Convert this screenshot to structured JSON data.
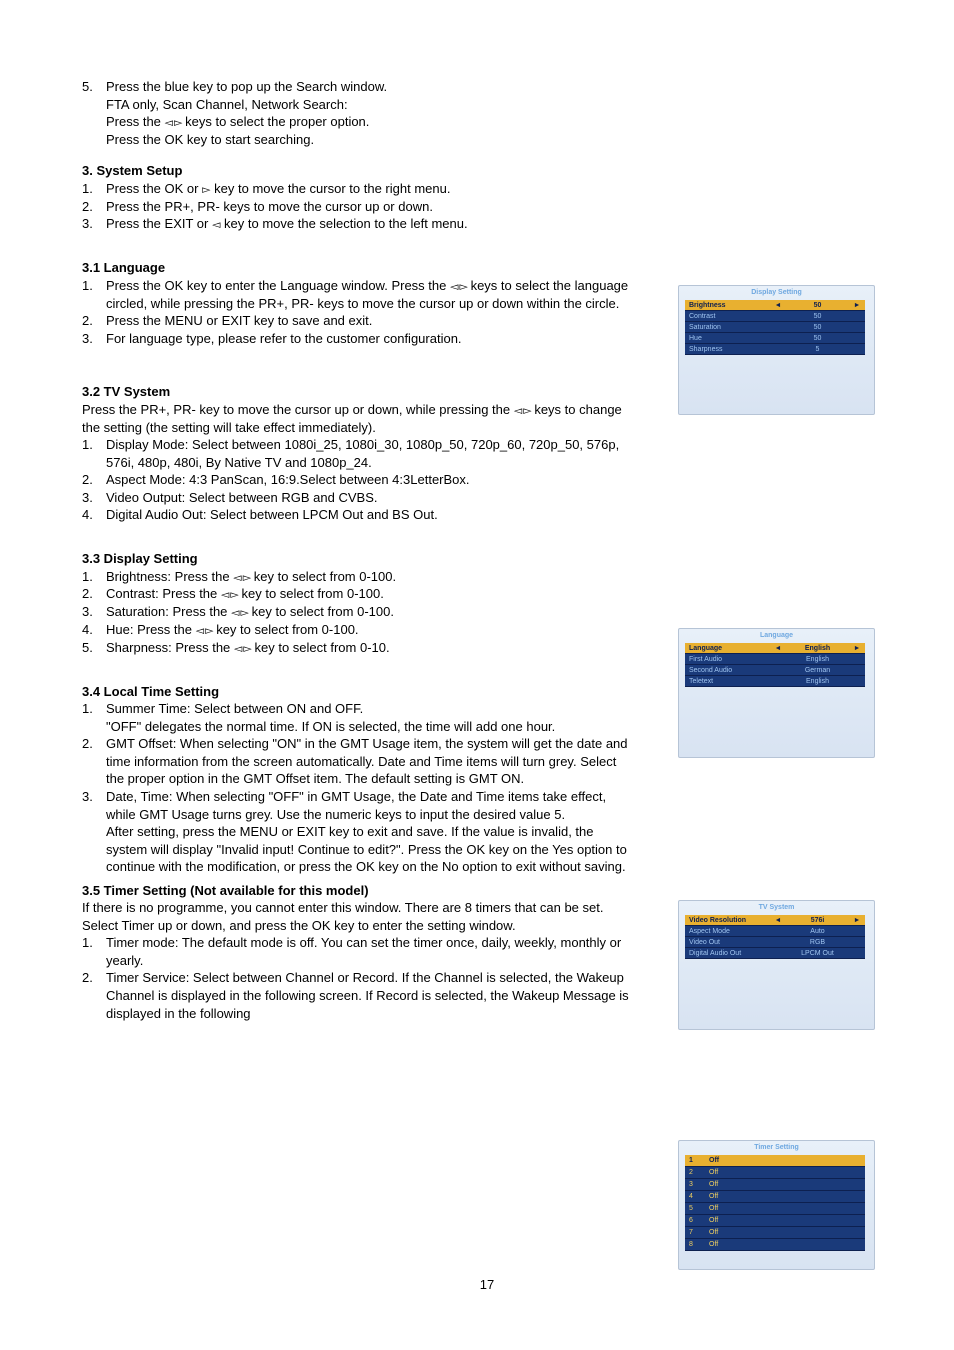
{
  "intro": {
    "item5_line1": "Press the blue key to pop up the Search window.",
    "item5_line2": "FTA only, Scan Channel, Network Search:",
    "item5_line3_a": "Press the ",
    "item5_line3_b": " keys to select the proper option.",
    "item5_line4": "Press the OK key to start searching."
  },
  "s3": {
    "title": "3.   System Setup",
    "items": [
      {
        "n": "1.",
        "a": "Press the OK or ",
        "icon": "r",
        "b": " key to move the cursor to the right menu."
      },
      {
        "n": "2.",
        "a": "Press the PR+, PR- keys to move the cursor up or down."
      },
      {
        "n": "3.",
        "a": "Press the EXIT or ",
        "icon": "l",
        "b": " key to move the selection to the left menu."
      }
    ]
  },
  "s31": {
    "title": "3.1  Language",
    "items": [
      {
        "n": "1.",
        "a": "Press the OK key to enter the Language window. Press the ",
        "icon": "lr",
        "b": " keys to select the language circled, while pressing the PR+, PR- keys to move the cursor up or down within the circle."
      },
      {
        "n": "2.",
        "a": "Press the MENU or EXIT key to save and exit."
      },
      {
        "n": "3.",
        "a": "For language type, please refer to the customer configuration."
      }
    ]
  },
  "s32": {
    "title": "3.2  TV System",
    "lead_a": "Press the PR+, PR- key to move the cursor up or down, while pressing the ",
    "lead_b": " keys to change the setting (the setting will take effect immediately).",
    "items": [
      {
        "n": "1.",
        "a": "Display Mode: Select between 1080i_25, 1080i_30, 1080p_50, 720p_60, 720p_50, 576p, 576i, 480p, 480i, By Native TV and 1080p_24."
      },
      {
        "n": "2.",
        "a": "Aspect Mode: 4:3 PanScan, 16:9.Select between 4:3LetterBox."
      },
      {
        "n": "3.",
        "a": "Video Output: Select between RGB and CVBS."
      },
      {
        "n": "4.",
        "a": "Digital Audio Out: Select between LPCM Out and BS Out."
      }
    ]
  },
  "s33": {
    "title": "3.3  Display Setting",
    "items": [
      {
        "n": "1.",
        "a": "Brightness: Press the ",
        "icon": "lr",
        "b": " key to select from 0-100."
      },
      {
        "n": "2.",
        "a": "Contrast: Press the ",
        "icon": "lr",
        "b": " key to select from 0-100."
      },
      {
        "n": "3.",
        "a": "Saturation: Press the ",
        "icon": "lr",
        "b": " key to select from 0-100."
      },
      {
        "n": "4.",
        "a": "Hue: Press the ",
        "icon": "lr",
        "b": " key to select from 0-100."
      },
      {
        "n": "5.",
        "a": "Sharpness: Press the ",
        "icon": "lr",
        "b": " key to select from 0-10."
      }
    ]
  },
  "s34": {
    "title": "3.4  Local Time Setting",
    "items": [
      {
        "n": "1.",
        "a": "Summer Time: Select between ON and OFF.",
        "cont": [
          "\"OFF\" delegates the normal time. If ON is selected, the time will add one hour."
        ]
      },
      {
        "n": "2.",
        "a": "GMT Offset: When selecting \"ON\" in the GMT Usage item, the system will get the date and time information from the screen automatically. Date and Time items will turn grey. Select the proper option in the GMT Offset item. The default setting is GMT ON."
      },
      {
        "n": "3.",
        "a": "Date, Time: When selecting \"OFF\" in GMT Usage, the Date and Time items take effect, while GMT Usage turns grey. Use the numeric keys to input the desired value 5.",
        "cont": [
          "After setting, press the MENU or EXIT key to exit and save. If the value is invalid, the system will display \"Invalid input! Continue to edit?\". Press the OK key on the Yes option to continue with the modification, or press the OK key on the No option to exit without saving."
        ]
      }
    ]
  },
  "s35": {
    "title": "3.5  Timer Setting (Not available for this model)",
    "lead1": "If there is no programme, you cannot enter this window. There are 8 timers that can be set.",
    "lead2": "Select Timer up or down, and press the OK key to enter the setting window.",
    "items": [
      {
        "n": "1.",
        "a": "Timer mode: The default mode is off. You can set the timer once, daily, weekly, monthly or yearly."
      },
      {
        "n": "2.",
        "a": "Timer Service: Select between Channel or Record. If the Channel is selected, the Wakeup Channel is displayed in the following screen. If Record is selected, the Wakeup Message is displayed in the following"
      }
    ]
  },
  "page_number": "17",
  "shots": {
    "display": {
      "title": "Display Setting",
      "rows": [
        {
          "k": "Brightness",
          "v": "50",
          "sel": true
        },
        {
          "k": "Contrast",
          "v": "50"
        },
        {
          "k": "Saturation",
          "v": "50"
        },
        {
          "k": "Hue",
          "v": "50"
        },
        {
          "k": "Sharpness",
          "v": "5"
        }
      ]
    },
    "language": {
      "title": "Language",
      "rows": [
        {
          "k": "Language",
          "v": "English",
          "sel": true
        },
        {
          "k": "First Audio",
          "v": "English"
        },
        {
          "k": "Second Audio",
          "v": "German"
        },
        {
          "k": "Teletext",
          "v": "English"
        }
      ]
    },
    "tvsys": {
      "title": "TV System",
      "rows": [
        {
          "k": "Video Resolution",
          "v": "576i",
          "sel": true
        },
        {
          "k": "Aspect Mode",
          "v": "Auto"
        },
        {
          "k": "Video Out",
          "v": "RGB"
        },
        {
          "k": "Digital Audio Out",
          "v": "LPCM Out"
        }
      ]
    },
    "timer": {
      "title": "Timer Setting",
      "rows": [
        {
          "k": "1",
          "v": "Off",
          "sel": true
        },
        {
          "k": "2",
          "v": "Off"
        },
        {
          "k": "3",
          "v": "Off"
        },
        {
          "k": "4",
          "v": "Off"
        },
        {
          "k": "5",
          "v": "Off"
        },
        {
          "k": "6",
          "v": "Off"
        },
        {
          "k": "7",
          "v": "Off"
        },
        {
          "k": "8",
          "v": "Off"
        }
      ]
    }
  }
}
